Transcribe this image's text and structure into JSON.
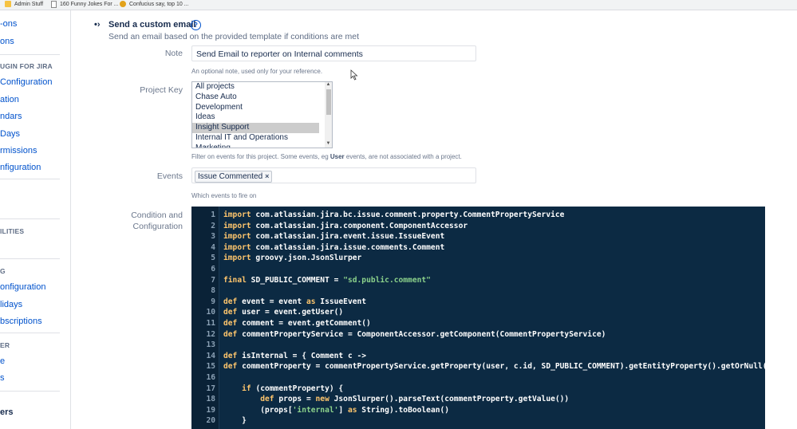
{
  "bookmarks": [
    {
      "label": "Admin Stuff",
      "icon": "folder-icon"
    },
    {
      "label": "160 Funny Jokes For ...",
      "icon": "page-icon"
    },
    {
      "label": "Confucius say, top 10 ...",
      "icon": "sun-icon"
    }
  ],
  "sidebar": {
    "items": [
      {
        "text": "-ons",
        "type": "link"
      },
      {
        "text": "ons",
        "type": "link"
      },
      {
        "text": "UGIN FOR JIRA",
        "type": "head"
      },
      {
        "text": "Configuration",
        "type": "link"
      },
      {
        "text": "ation",
        "type": "link"
      },
      {
        "text": "ndars",
        "type": "link"
      },
      {
        "text": "Days",
        "type": "link"
      },
      {
        "text": "rmissions",
        "type": "link"
      },
      {
        "text": "nfiguration",
        "type": "link"
      },
      {
        "text": "ILITIES",
        "type": "head"
      },
      {
        "text": "G",
        "type": "head"
      },
      {
        "text": "onfiguration",
        "type": "link"
      },
      {
        "text": "lidays",
        "type": "link"
      },
      {
        "text": "bscriptions",
        "type": "link"
      },
      {
        "text": "ER",
        "type": "head"
      },
      {
        "text": "e",
        "type": "link"
      },
      {
        "text": "s",
        "type": "link"
      },
      {
        "text": "ers",
        "type": "dark"
      }
    ]
  },
  "section": {
    "title": "Send a custom email",
    "help_icon": "question-circle-icon",
    "description": "Send an email based on the provided template if conditions are met"
  },
  "form": {
    "note_label": "Note",
    "note_value": "Send Email to reporter on Internal comments",
    "note_hint": "An optional note, used only for your reference.",
    "project_label": "Project Key",
    "project_options": [
      {
        "label": "All projects",
        "selected": false
      },
      {
        "label": "Chase Auto",
        "selected": false
      },
      {
        "label": "Development",
        "selected": false
      },
      {
        "label": "Ideas",
        "selected": false
      },
      {
        "label": "Insight Support",
        "selected": true
      },
      {
        "label": "Internal IT and Operations",
        "selected": false
      },
      {
        "label": "Marketing",
        "selected": false
      }
    ],
    "project_hint_pre": "Filter on events for this project. Some events, eg ",
    "project_hint_bold": "User",
    "project_hint_post": " events, are not associated with a project.",
    "events_label": "Events",
    "events_tag": "Issue Commented",
    "events_hint": "Which events to fire on",
    "condition_label_1": "Condition and",
    "condition_label_2": "Configuration"
  },
  "code_lines": [
    {
      "n": "1",
      "parts": [
        [
          "kw",
          "import"
        ],
        [
          "t",
          " com.atlassian.jira.bc.issue.comment.property.CommentPropertyService"
        ]
      ]
    },
    {
      "n": "2",
      "parts": [
        [
          "kw",
          "import"
        ],
        [
          "t",
          " com.atlassian.jira.component.ComponentAccessor"
        ]
      ]
    },
    {
      "n": "3",
      "parts": [
        [
          "kw",
          "import"
        ],
        [
          "t",
          " com.atlassian.jira.event.issue.IssueEvent"
        ]
      ]
    },
    {
      "n": "4",
      "parts": [
        [
          "kw",
          "import"
        ],
        [
          "t",
          " com.atlassian.jira.issue.comments.Comment"
        ]
      ]
    },
    {
      "n": "5",
      "parts": [
        [
          "kw",
          "import"
        ],
        [
          "t",
          " groovy.json.JsonSlurper"
        ]
      ]
    },
    {
      "n": "6",
      "parts": []
    },
    {
      "n": "7",
      "parts": [
        [
          "kw",
          "final"
        ],
        [
          "t",
          " SD_PUBLIC_COMMENT = "
        ],
        [
          "str",
          "\"sd.public.comment\""
        ]
      ]
    },
    {
      "n": "8",
      "parts": []
    },
    {
      "n": "9",
      "parts": [
        [
          "kw",
          "def"
        ],
        [
          "t",
          " event = event "
        ],
        [
          "kw",
          "as"
        ],
        [
          "t",
          " IssueEvent"
        ]
      ]
    },
    {
      "n": "10",
      "parts": [
        [
          "kw",
          "def"
        ],
        [
          "t",
          " user = event.getUser()"
        ]
      ]
    },
    {
      "n": "11",
      "parts": [
        [
          "kw",
          "def"
        ],
        [
          "t",
          " comment = event.getComment()"
        ]
      ]
    },
    {
      "n": "12",
      "parts": [
        [
          "kw",
          "def"
        ],
        [
          "t",
          " commentPropertyService = ComponentAccessor.getComponent(CommentPropertyService)"
        ]
      ]
    },
    {
      "n": "13",
      "parts": []
    },
    {
      "n": "14",
      "parts": [
        [
          "kw",
          "def"
        ],
        [
          "t",
          " isInternal = { Comment c ->"
        ]
      ]
    },
    {
      "n": "15",
      "parts": [
        [
          "kw",
          "def"
        ],
        [
          "t",
          " commentProperty = commentPropertyService.getProperty(user, c.id, SD_PUBLIC_COMMENT).getEntityProperty().getOrNull()"
        ]
      ]
    },
    {
      "n": "16",
      "parts": []
    },
    {
      "n": "17",
      "parts": [
        [
          "t",
          "    "
        ],
        [
          "kw",
          "if"
        ],
        [
          "t",
          " (commentProperty) {"
        ]
      ]
    },
    {
      "n": "18",
      "parts": [
        [
          "t",
          "        "
        ],
        [
          "kw",
          "def"
        ],
        [
          "t",
          " props = "
        ],
        [
          "kw",
          "new"
        ],
        [
          "t",
          " JsonSlurper().parseText(commentProperty.getValue())"
        ]
      ]
    },
    {
      "n": "19",
      "parts": [
        [
          "t",
          "        (props["
        ],
        [
          "str",
          "'internal'"
        ],
        [
          "t",
          "] "
        ],
        [
          "kw",
          "as"
        ],
        [
          "t",
          " String).toBoolean()"
        ]
      ]
    },
    {
      "n": "20",
      "parts": [
        [
          "t",
          "    }"
        ]
      ]
    }
  ]
}
